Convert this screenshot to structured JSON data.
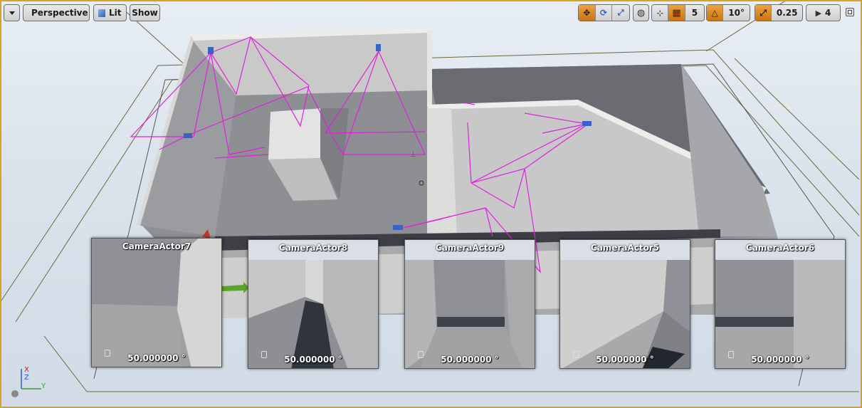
{
  "toolbar": {
    "menu_dropdown_icon": "chevron-down-icon",
    "view_mode_label": "Perspective",
    "lighting_label": "Lit",
    "show_label": "Show",
    "grid_snap_value": "5",
    "rotation_snap_value": "10°",
    "scale_snap_value": "0.25",
    "camera_speed_value": "4"
  },
  "cameras": [
    {
      "title": "CameraActor7",
      "fov": "50.000000 °"
    },
    {
      "title": "CameraActor8",
      "fov": "50.000000 °"
    },
    {
      "title": "CameraActor9",
      "fov": "50.000000 °"
    },
    {
      "title": "CameraActor5",
      "fov": "50.000000 °"
    },
    {
      "title": "CameraActor6",
      "fov": "50.000000 °"
    }
  ],
  "axis": {
    "x": "X",
    "z": "Z",
    "y": "Y"
  },
  "colors": {
    "frustum": "#e020e0",
    "accent": "#e08a1e",
    "viewport_border": "#d8a222"
  }
}
